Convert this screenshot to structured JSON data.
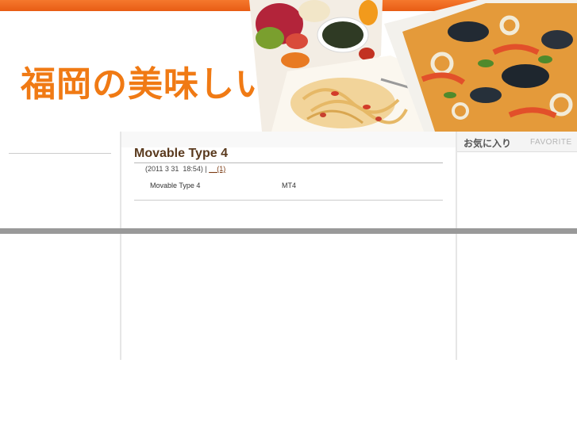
{
  "header": {
    "site_title": "福岡の美味しいお店",
    "brand_color": "#f07a14",
    "photo": "food-collage"
  },
  "post": {
    "title": "Movable Type 4",
    "meta_date": "(2011 3 31  18:54) | ",
    "meta_link": "__(1)",
    "entry_text": "Movable Type 4",
    "entry_tag": "MT4"
  },
  "sidebar_right": {
    "heading_jp": "お気に入り",
    "heading_en": "FAVORITE"
  }
}
